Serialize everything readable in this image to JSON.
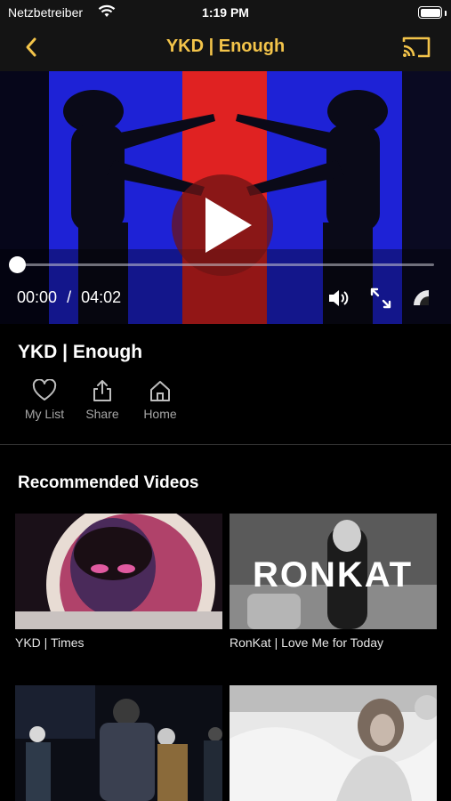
{
  "status_bar": {
    "carrier": "Netzbetreiber",
    "time": "1:19 PM"
  },
  "nav": {
    "title": "YKD | Enough"
  },
  "player": {
    "current_time": "00:00",
    "separator": "/",
    "duration": "04:02",
    "progress": 0
  },
  "video": {
    "title": "YKD | Enough"
  },
  "actions": [
    {
      "label": "My List",
      "icon": "heart-icon"
    },
    {
      "label": "Share",
      "icon": "share-icon"
    },
    {
      "label": "Home",
      "icon": "home-icon"
    }
  ],
  "recommended": {
    "title": "Recommended Videos",
    "items": [
      {
        "label": "YKD | Times"
      },
      {
        "label": "RonKat | Love Me for Today",
        "overlay_text": "RONKAT"
      },
      {
        "label": ""
      },
      {
        "label": ""
      }
    ]
  },
  "colors": {
    "accent": "#f3c44a",
    "background": "#000000",
    "bar": "#141414"
  }
}
